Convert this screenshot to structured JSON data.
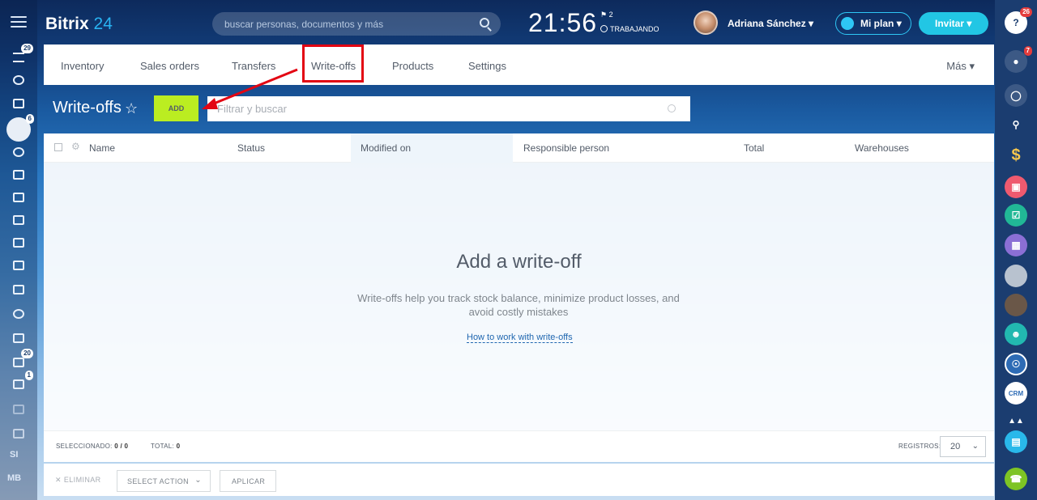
{
  "app": {
    "brand": "Bitrix",
    "brand_num": "24"
  },
  "header": {
    "search_placeholder": "buscar personas, documentos y más",
    "clock": "21:56",
    "flag_count": "2",
    "work_status": "TRABAJANDO",
    "user_name": "Adriana Sánchez",
    "plan_label": "Mi plan",
    "invite_label": "Invitar"
  },
  "left_sidebar": {
    "badges": [
      "29",
      "6",
      "20",
      "1"
    ],
    "user_initials": [
      "SI",
      "MB"
    ]
  },
  "right_sidebar": {
    "badges": [
      "26",
      "7"
    ],
    "crm_label": "CRM"
  },
  "tabs": [
    {
      "label": "Inventory"
    },
    {
      "label": "Sales orders"
    },
    {
      "label": "Transfers"
    },
    {
      "label": "Write-offs"
    },
    {
      "label": "Products"
    },
    {
      "label": "Settings"
    }
  ],
  "more_label": "Más",
  "page": {
    "title": "Write-offs",
    "add_label": "ADD",
    "filter_placeholder": "Filtrar y buscar"
  },
  "grid": {
    "columns": [
      "Name",
      "Status",
      "Modified on",
      "Responsible person",
      "Total",
      "Warehouses"
    ],
    "empty_title": "Add a write-off",
    "empty_desc": "Write-offs help you track stock balance, minimize product losses, and avoid costly mistakes",
    "empty_link": "How to work with write-offs"
  },
  "footer": {
    "selected_label": "SELECCIONADO:",
    "selected_value": "0 / 0",
    "total_label": "TOTAL:",
    "total_value": "0",
    "records_label": "REGISTROS:",
    "records_value": "20"
  },
  "actions": {
    "delete_label": "ELIMINAR",
    "select_action_label": "SELECT ACTION",
    "apply_label": "APLICAR"
  },
  "colors": {
    "add_button": "#bbed21",
    "highlight_box": "#e30613",
    "accent": "#22c6e4"
  }
}
